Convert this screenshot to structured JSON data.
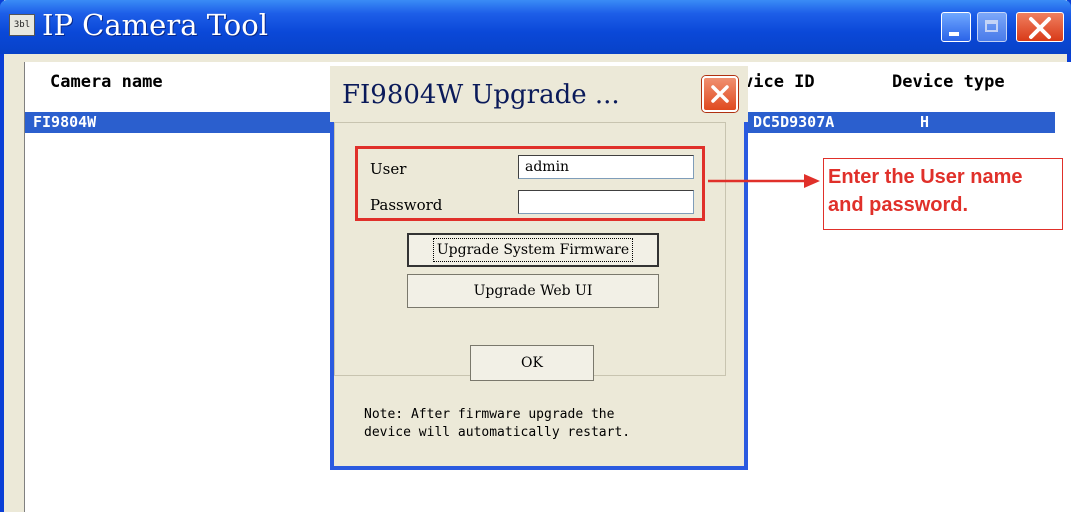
{
  "window": {
    "title": "IP Camera Tool",
    "icon": "camera-tool-icon",
    "icon_text": "3bl"
  },
  "list": {
    "columns": [
      "Camera name",
      "vice ID",
      "Device type"
    ],
    "rows": [
      {
        "name": "FI9804W",
        "device_id": "DC5D9307A",
        "device_type": "H"
      }
    ]
  },
  "dialog": {
    "title": "FI9804W Upgrade ...",
    "user_label": "User",
    "user_value": "admin",
    "password_label": "Password",
    "password_value": "",
    "upgrade_firmware_label": "Upgrade System Firmware",
    "upgrade_webui_label": "Upgrade Web UI",
    "ok_label": "OK",
    "note": "Note: After firmware upgrade the\ndevice will automatically restart."
  },
  "annotation": {
    "text": "Enter the User name\nand password.",
    "color": "#E0302A"
  },
  "colors": {
    "titlebar": "#0A48D8",
    "selection": "#2B5FCE",
    "dialog_bg": "#ECE9D8",
    "highlight": "#E0302A"
  }
}
